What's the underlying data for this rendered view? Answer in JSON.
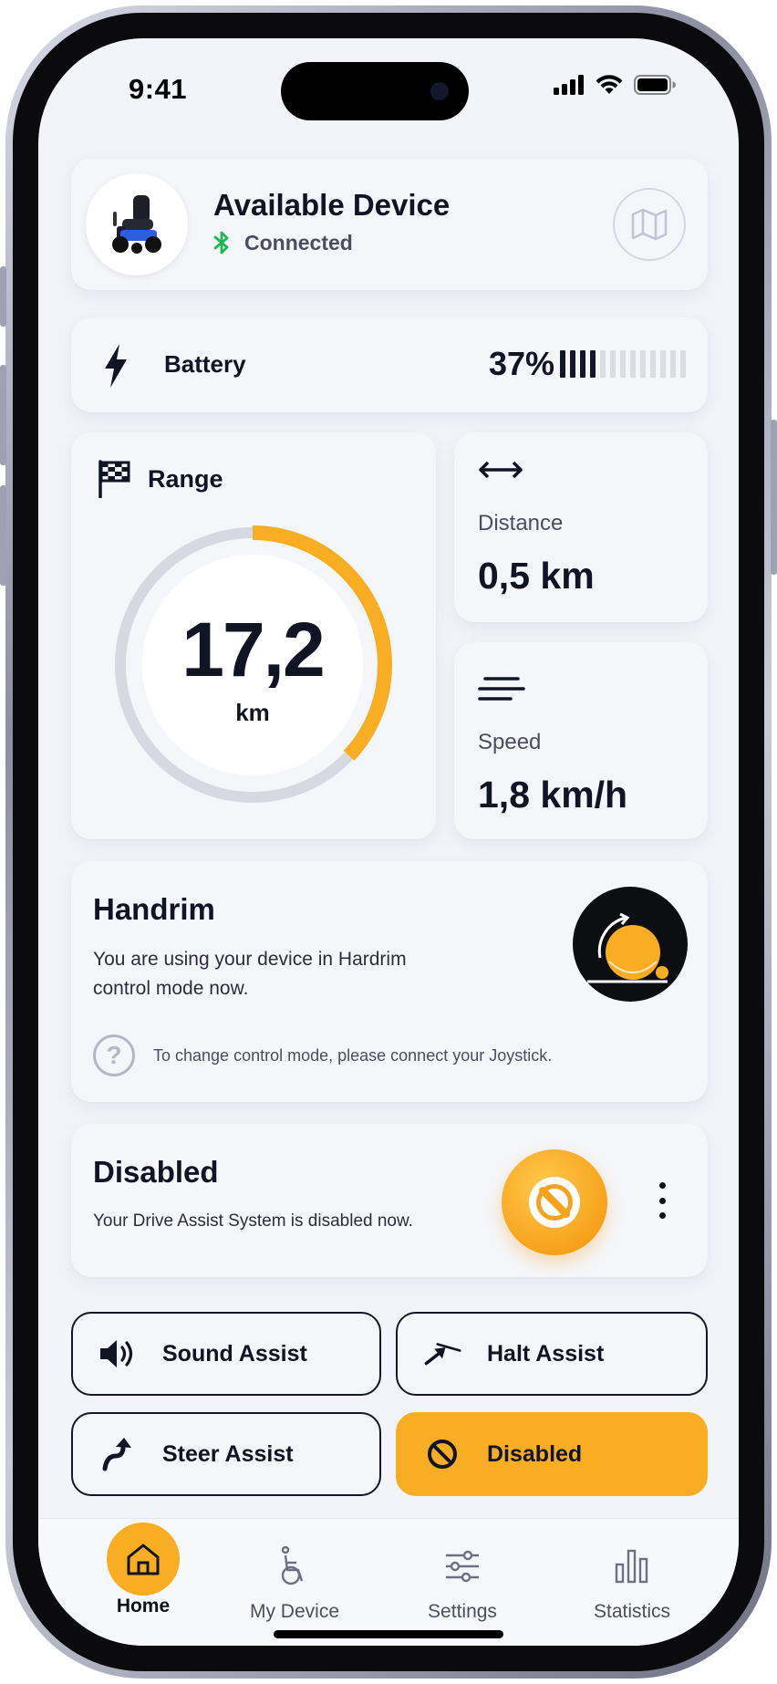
{
  "status_bar": {
    "time": "9:41"
  },
  "device": {
    "title": "Available Device",
    "status": "Connected",
    "icons": {
      "bluetooth": "bluetooth-icon",
      "map": "map-icon"
    }
  },
  "battery": {
    "label": "Battery",
    "value": "37%",
    "level": 0.37,
    "bars_total": 13,
    "bars_filled": 4
  },
  "range": {
    "label": "Range",
    "value": "17,2",
    "unit": "km",
    "progress": 0.37
  },
  "distance": {
    "label": "Distance",
    "value": "0,5 km"
  },
  "speed": {
    "label": "Speed",
    "value": "1,8 km/h"
  },
  "handrim": {
    "title": "Handrim",
    "description": "You are using your device in Hardrim control mode now.",
    "hint": "To change control mode, please connect your Joystick."
  },
  "assist": {
    "title": "Disabled",
    "description": "Your Drive Assist System is disabled now."
  },
  "modes": {
    "sound": "Sound Assist",
    "halt": "Halt Assist",
    "steer": "Steer Assist",
    "disabled": "Disabled"
  },
  "tabs": [
    {
      "label": "Home",
      "active": true
    },
    {
      "label": "My Device",
      "active": false
    },
    {
      "label": "Settings",
      "active": false
    },
    {
      "label": "Statistics",
      "active": false
    }
  ],
  "colors": {
    "accent": "#F8AD22",
    "text": "#111423",
    "background": "#F2F4F9",
    "bluetooth": "#22B455",
    "gauge_track": "#D6D9E0"
  }
}
